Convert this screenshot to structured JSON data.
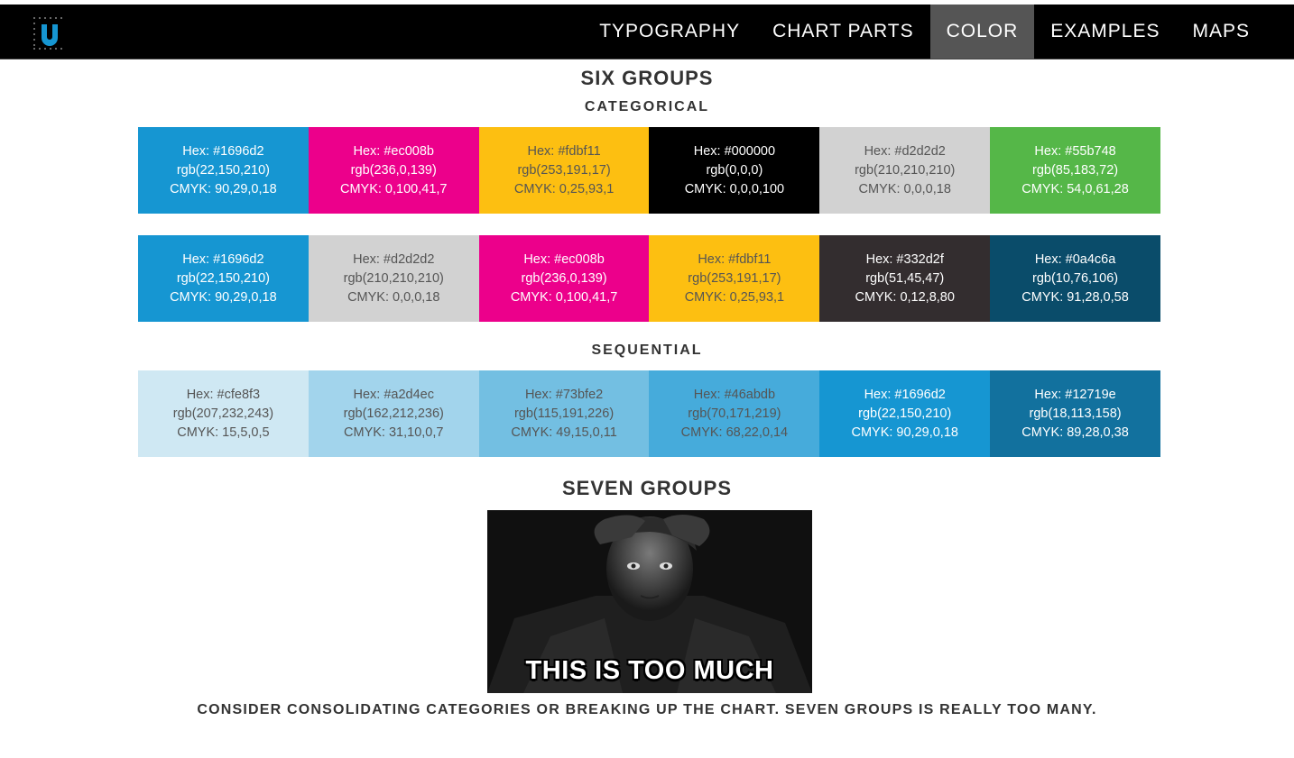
{
  "nav": {
    "items": [
      {
        "label": "TYPOGRAPHY",
        "active": false
      },
      {
        "label": "CHART PARTS",
        "active": false
      },
      {
        "label": "COLOR",
        "active": true
      },
      {
        "label": "EXAMPLES",
        "active": false
      },
      {
        "label": "MAPS",
        "active": false
      }
    ]
  },
  "logo": {
    "letter": "U",
    "color": "#1696d2"
  },
  "six_groups": {
    "title": "SIX GROUPS",
    "categorical_label": "CATEGORICAL",
    "sequential_label": "SEQUENTIAL",
    "categorical_row1": [
      {
        "hex": "Hex: #1696d2",
        "rgb": "rgb(22,150,210)",
        "cmyk": "CMYK: 90,29,0,18",
        "bg": "#1696d2",
        "fg": "#ffffff"
      },
      {
        "hex": "Hex: #ec008b",
        "rgb": "rgb(236,0,139)",
        "cmyk": "CMYK: 0,100,41,7",
        "bg": "#ec008b",
        "fg": "#ffffff"
      },
      {
        "hex": "Hex: #fdbf11",
        "rgb": "rgb(253,191,17)",
        "cmyk": "CMYK: 0,25,93,1",
        "bg": "#fdbf11",
        "fg": "#555555"
      },
      {
        "hex": "Hex: #000000",
        "rgb": "rgb(0,0,0)",
        "cmyk": "CMYK: 0,0,0,100",
        "bg": "#000000",
        "fg": "#ffffff"
      },
      {
        "hex": "Hex: #d2d2d2",
        "rgb": "rgb(210,210,210)",
        "cmyk": "CMYK: 0,0,0,18",
        "bg": "#d2d2d2",
        "fg": "#555555"
      },
      {
        "hex": "Hex: #55b748",
        "rgb": "rgb(85,183,72)",
        "cmyk": "CMYK: 54,0,61,28",
        "bg": "#55b748",
        "fg": "#ffffff"
      }
    ],
    "categorical_row2": [
      {
        "hex": "Hex: #1696d2",
        "rgb": "rgb(22,150,210)",
        "cmyk": "CMYK: 90,29,0,18",
        "bg": "#1696d2",
        "fg": "#ffffff"
      },
      {
        "hex": "Hex: #d2d2d2",
        "rgb": "rgb(210,210,210)",
        "cmyk": "CMYK: 0,0,0,18",
        "bg": "#d2d2d2",
        "fg": "#555555"
      },
      {
        "hex": "Hex: #ec008b",
        "rgb": "rgb(236,0,139)",
        "cmyk": "CMYK: 0,100,41,7",
        "bg": "#ec008b",
        "fg": "#ffffff"
      },
      {
        "hex": "Hex: #fdbf11",
        "rgb": "rgb(253,191,17)",
        "cmyk": "CMYK: 0,25,93,1",
        "bg": "#fdbf11",
        "fg": "#555555"
      },
      {
        "hex": "Hex: #332d2f",
        "rgb": "rgb(51,45,47)",
        "cmyk": "CMYK: 0,12,8,80",
        "bg": "#332d2f",
        "fg": "#ffffff"
      },
      {
        "hex": "Hex: #0a4c6a",
        "rgb": "rgb(10,76,106)",
        "cmyk": "CMYK: 91,28,0,58",
        "bg": "#0a4c6a",
        "fg": "#ffffff"
      }
    ],
    "sequential_row": [
      {
        "hex": "Hex: #cfe8f3",
        "rgb": "rgb(207,232,243)",
        "cmyk": "CMYK: 15,5,0,5",
        "bg": "#cfe8f3",
        "fg": "#555555"
      },
      {
        "hex": "Hex: #a2d4ec",
        "rgb": "rgb(162,212,236)",
        "cmyk": "CMYK: 31,10,0,7",
        "bg": "#a2d4ec",
        "fg": "#555555"
      },
      {
        "hex": "Hex: #73bfe2",
        "rgb": "rgb(115,191,226)",
        "cmyk": "CMYK: 49,15,0,11",
        "bg": "#73bfe2",
        "fg": "#555555"
      },
      {
        "hex": "Hex: #46abdb",
        "rgb": "rgb(70,171,219)",
        "cmyk": "CMYK: 68,22,0,14",
        "bg": "#46abdb",
        "fg": "#555555"
      },
      {
        "hex": "Hex: #1696d2",
        "rgb": "rgb(22,150,210)",
        "cmyk": "CMYK: 90,29,0,18",
        "bg": "#1696d2",
        "fg": "#ffffff"
      },
      {
        "hex": "Hex: #12719e",
        "rgb": "rgb(18,113,158)",
        "cmyk": "CMYK: 89,28,0,38",
        "bg": "#12719e",
        "fg": "#ffffff"
      }
    ]
  },
  "seven_groups": {
    "title": "SEVEN GROUPS",
    "meme_caption": "THIS IS TOO MUCH",
    "note": "CONSIDER CONSOLIDATING CATEGORIES OR BREAKING UP THE CHART. SEVEN GROUPS IS REALLY TOO MANY."
  }
}
